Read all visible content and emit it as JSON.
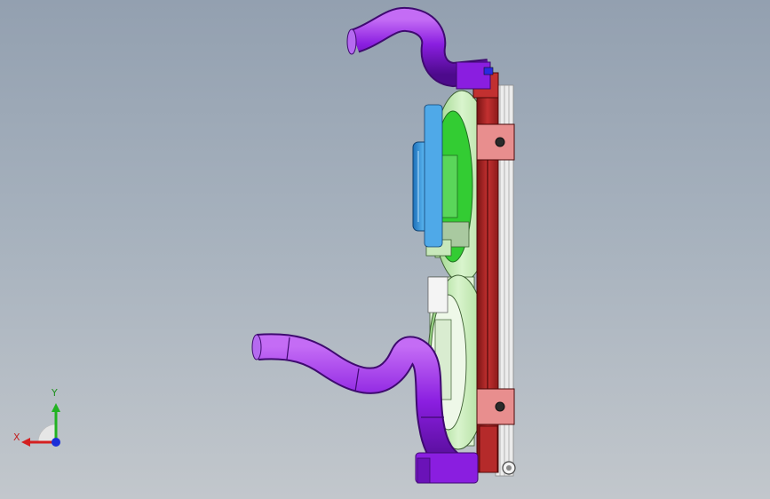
{
  "viewport": {
    "background_top": "#93a0b0",
    "background_bottom": "#c2c7cc"
  },
  "model": {
    "parts": [
      {
        "name": "upper-hose",
        "color": "#8a1ee0"
      },
      {
        "name": "lower-hose",
        "color": "#8a1ee0"
      },
      {
        "name": "fan-shroud-upper",
        "color": "#c9eeb6"
      },
      {
        "name": "fan-hub-upper",
        "color": "#33cc33"
      },
      {
        "name": "fan-shroud-lower",
        "color": "#d6f0c8"
      },
      {
        "name": "motor-cover",
        "color": "#3fa3e6"
      },
      {
        "name": "radiator-frame",
        "color": "#b42626"
      },
      {
        "name": "radiator-core",
        "color": "#e8e8e8"
      }
    ]
  },
  "triad": {
    "x_label": "X",
    "y_label": "Y",
    "x_color": "#d42020",
    "y_color": "#22b222",
    "z_color": "#1a2ed8"
  }
}
